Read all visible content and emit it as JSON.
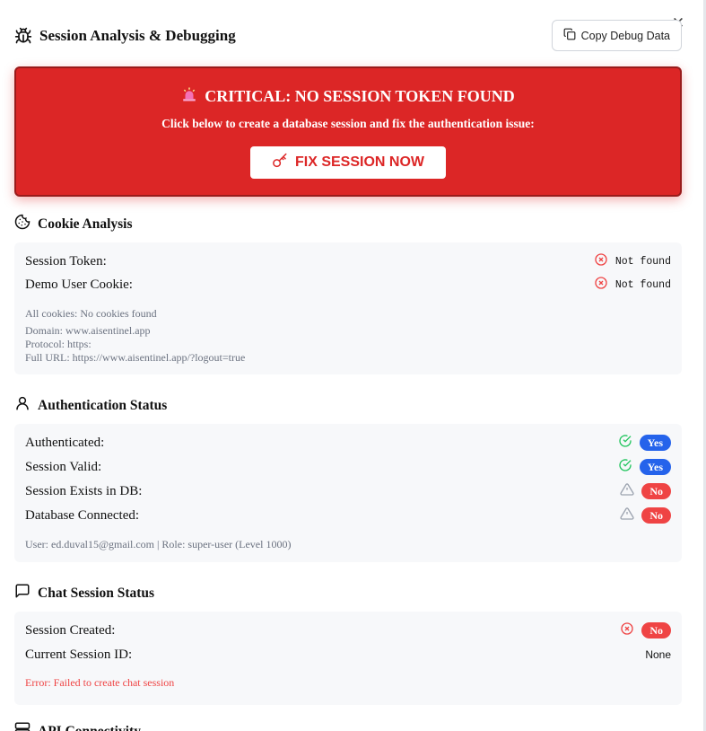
{
  "header": {
    "title": "Session Analysis & Debugging",
    "copy_label": "Copy Debug Data",
    "close_glyph": "✕"
  },
  "critical": {
    "title": "CRITICAL: NO SESSION TOKEN FOUND",
    "subtitle": "Click below to create a database session and fix the authentication issue:",
    "button_label": "FIX SESSION NOW",
    "bg_color": "#dc2626"
  },
  "cookie": {
    "title": "Cookie Analysis",
    "rows": [
      {
        "label": "Session Token:",
        "value": "Not found",
        "icon": "x-circle-icon"
      },
      {
        "label": "Demo User Cookie:",
        "value": "Not found",
        "icon": "x-circle-icon"
      }
    ],
    "all_cookies": "All cookies: No cookies found",
    "domain": "Domain: www.aisentinel.app",
    "protocol": "Protocol: https:",
    "full_url": "Full URL: https://www.aisentinel.app/?logout=true"
  },
  "auth": {
    "title": "Authentication Status",
    "rows": [
      {
        "label": "Authenticated:",
        "value": "Yes",
        "icon": "check-circle-icon"
      },
      {
        "label": "Session Valid:",
        "value": "Yes",
        "icon": "check-circle-icon"
      },
      {
        "label": "Session Exists in DB:",
        "value": "No",
        "icon": "warning-triangle-icon"
      },
      {
        "label": "Database Connected:",
        "value": "No",
        "icon": "warning-triangle-icon"
      }
    ],
    "user_info": "User: ed.duval15@gmail.com | Role: super-user (Level 1000)"
  },
  "chat": {
    "title": "Chat Session Status",
    "rows": [
      {
        "label": "Session Created:",
        "value": "No",
        "icon": "x-circle-icon"
      },
      {
        "label": "Current Session ID:",
        "value": "None"
      }
    ],
    "error": "Error: Failed to create chat session"
  },
  "api": {
    "title": "API Connectivity"
  }
}
